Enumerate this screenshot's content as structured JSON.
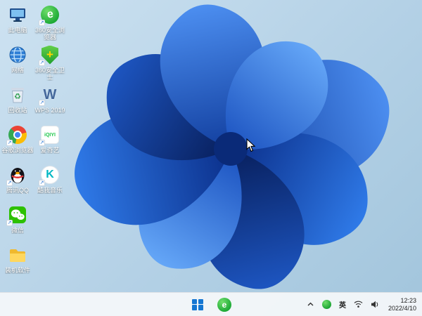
{
  "desktop": {
    "icons": {
      "this_pc": "此电脑",
      "browser360": "360安全浏览器",
      "network": "网络",
      "safety360": "360安全卫士",
      "recycle_bin": "回收站",
      "wps": "WPS 2019",
      "chrome": "谷歌浏览器",
      "iqiyi": "爱奇艺",
      "qq": "腾讯QQ",
      "kuwo": "酷我音乐",
      "wechat": "微信",
      "software_folder": "装机软件"
    },
    "icon_glyphs": {
      "browser360_letter": "e",
      "safety360_plus": "+",
      "wps_letter": "W",
      "iqiyi_wordmark": "iQIYI",
      "kuwo_letter": "K",
      "shortcut_arrow": "↗"
    }
  },
  "taskbar": {
    "tray": {
      "input_indicator": "英",
      "time": "12:23",
      "date": "2022/4/10"
    }
  },
  "colors": {
    "accent_blue": "#1576d2",
    "taskbar_bg": "#f3f6f9",
    "bloom_dark": "#0a2a78",
    "bloom_light": "#4c8ef0",
    "desktop_bg": "#b4d1e6"
  }
}
